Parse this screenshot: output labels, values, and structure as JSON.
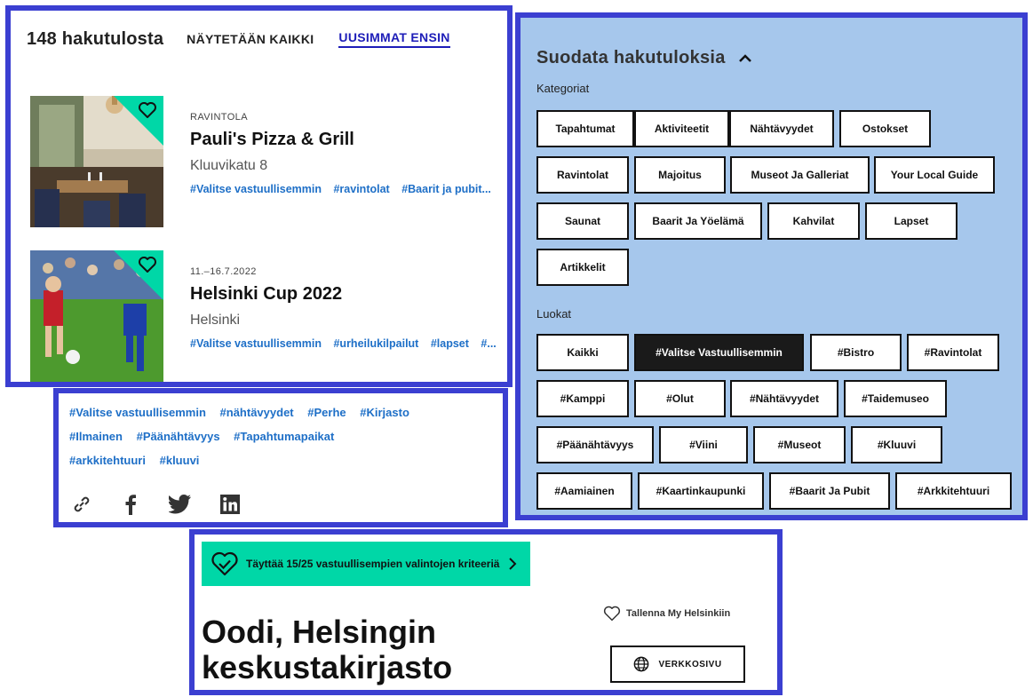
{
  "results": {
    "count": "148 hakutulosta",
    "show_all": "NÄYTETÄÄN KAIKKI",
    "sort": "UUSIMMAT ENSIN",
    "cards": [
      {
        "meta": "RAVINTOLA",
        "title": "Pauli's Pizza & Grill",
        "location": "Kluuvikatu 8",
        "tags": [
          "#Valitse vastuullisemmin",
          "#ravintolat",
          "#Baarit ja pubit..."
        ]
      },
      {
        "meta": "11.–16.7.2022",
        "title": "Helsinki Cup 2022",
        "location": "Helsinki",
        "tags": [
          "#Valitse vastuullisemmin",
          "#urheilukilpailut",
          "#lapset",
          "#..."
        ]
      }
    ]
  },
  "tag_panel": {
    "tags": [
      "#Valitse vastuullisemmin",
      "#nähtävyydet",
      "#Perhe",
      "#Kirjasto",
      "#Ilmainen",
      "#Päänähtävyys",
      "#Tapahtumapaikat",
      "#arkkitehtuuri",
      "#kluuvi"
    ],
    "share_icons": [
      "link-icon",
      "facebook-icon",
      "twitter-icon",
      "linkedin-icon"
    ]
  },
  "filters": {
    "title": "Suodata hakutuloksia",
    "categories_label": "Kategoriat",
    "categories": [
      "Tapahtumat",
      "Aktiviteetit",
      "Nähtävyydet",
      "Ostokset",
      "Ravintolat",
      "Majoitus",
      "Museot Ja Galleriat",
      "Your Local Guide",
      "Saunat",
      "Baarit Ja Yöelämä",
      "Kahvilat",
      "Lapset",
      "Artikkelit"
    ],
    "classes_label": "Luokat",
    "classes": [
      "Kaikki",
      "#Valitse Vastuullisemmin",
      "#Bistro",
      "#Ravintolat",
      "#Kamppi",
      "#Olut",
      "#Nähtävyydet",
      "#Taidemuseo",
      "#Päänähtävyys",
      "#Viini",
      "#Museot",
      "#Kluuvi",
      "#Aamiainen",
      "#Kaartinkaupunki",
      "#Baarit Ja Pubit",
      "#Arkkitehtuuri"
    ],
    "active_class": "#Valitse Vastuullisemmin"
  },
  "detail": {
    "criteria": "Täyttää 15/25 vastuullisempien valintojen kriteeriä",
    "title": "Oodi, Helsingin keskustakirjasto",
    "save_label": "Tallenna My Helsinkiin",
    "website_label": "VERKKOSIVU"
  },
  "colors": {
    "frame": "#3b3fd1",
    "accent_green": "#00d7a7",
    "filter_bg": "#a6c7ec",
    "tag_blue": "#1e6fc7",
    "link_blue": "#1d1db8"
  }
}
